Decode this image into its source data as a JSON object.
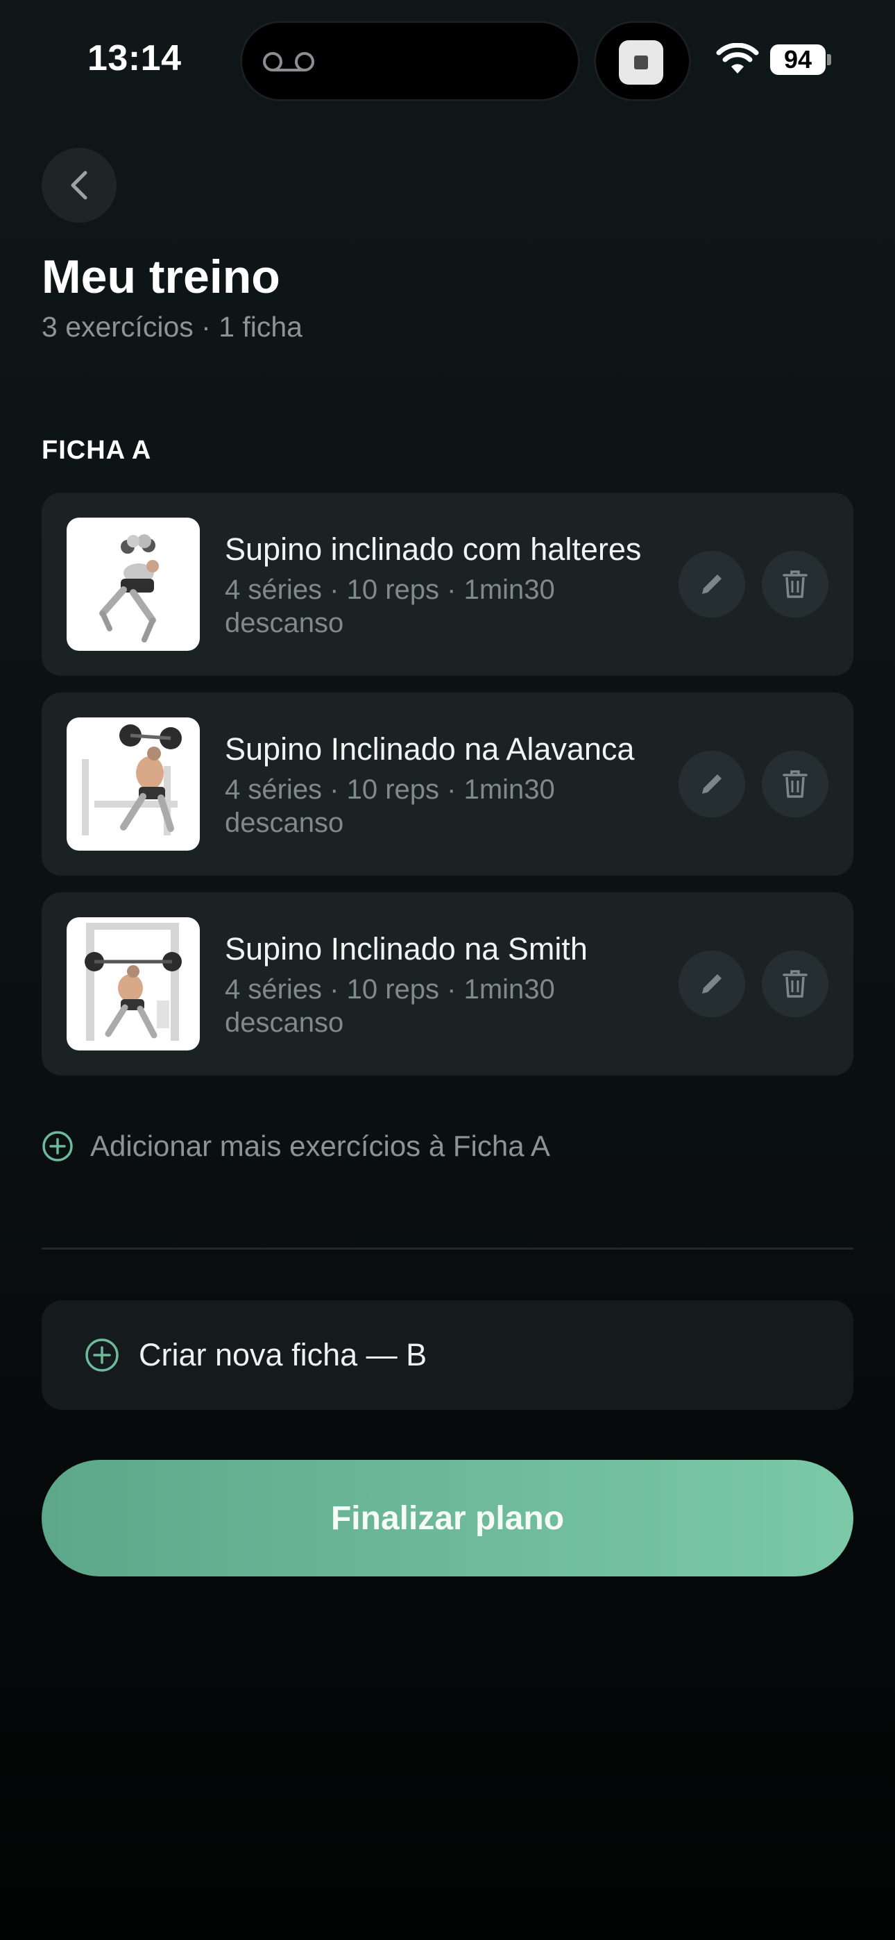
{
  "status_bar": {
    "time": "13:14",
    "battery": "94"
  },
  "header": {
    "title": "Meu treino",
    "subtitle": "3 exercícios · 1 ficha"
  },
  "section": {
    "label": "FICHA A"
  },
  "exercises": [
    {
      "name": "Supino inclinado com halteres",
      "meta": "4 séries · 10 reps · 1min30 descanso"
    },
    {
      "name": "Supino Inclinado na Alavanca",
      "meta": "4 séries · 10 reps · 1min30 descanso"
    },
    {
      "name": "Supino Inclinado na Smith",
      "meta": "4 séries · 10 reps · 1min30 descanso"
    }
  ],
  "add_more_label": "Adicionar mais exercícios à Ficha A",
  "new_sheet_label": "Criar nova ficha — B",
  "finish_label": "Finalizar plano",
  "colors": {
    "accent": "#6dbb9a",
    "background": "#0b1012",
    "card": "#1a2224"
  },
  "icons": [
    "back-chevron-icon",
    "edit-pencil-icon",
    "trash-icon",
    "plus-circle-icon",
    "wifi-icon",
    "voicemail-icon"
  ]
}
